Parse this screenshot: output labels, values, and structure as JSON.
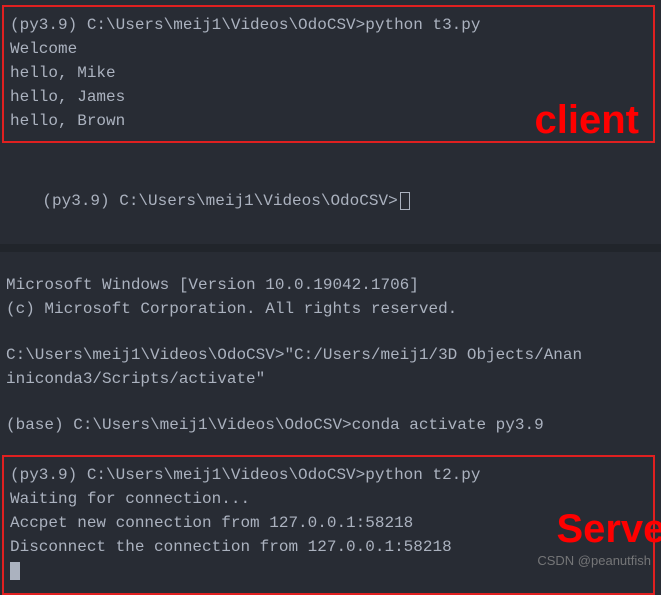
{
  "client": {
    "line1": "(py3.9) C:\\Users\\meij1\\Videos\\OdoCSV>python t3.py",
    "line2": "Welcome",
    "line3": "hello, Mike",
    "line4": "hello, James",
    "line5": "hello, Brown"
  },
  "prompt_idle": "(py3.9) C:\\Users\\meij1\\Videos\\OdoCSV>",
  "middle": {
    "line1": "Microsoft Windows [Version 10.0.19042.1706]",
    "line2": "(c) Microsoft Corporation. All rights reserved.",
    "line3": "C:\\Users\\meij1\\Videos\\OdoCSV>\"C:/Users/meij1/3D Objects/Anan",
    "line4": "iniconda3/Scripts/activate\"",
    "line5": "(base) C:\\Users\\meij1\\Videos\\OdoCSV>conda activate py3.9"
  },
  "server": {
    "line1": "(py3.9) C:\\Users\\meij1\\Videos\\OdoCSV>python t2.py",
    "line2": "Waiting for connection...",
    "line3": "Accpet new connection from 127.0.0.1:58218",
    "line4": "Disconnect the connection from 127.0.0.1:58218"
  },
  "labels": {
    "client": "client",
    "server": "Server"
  },
  "watermark": "CSDN @peanutfish"
}
